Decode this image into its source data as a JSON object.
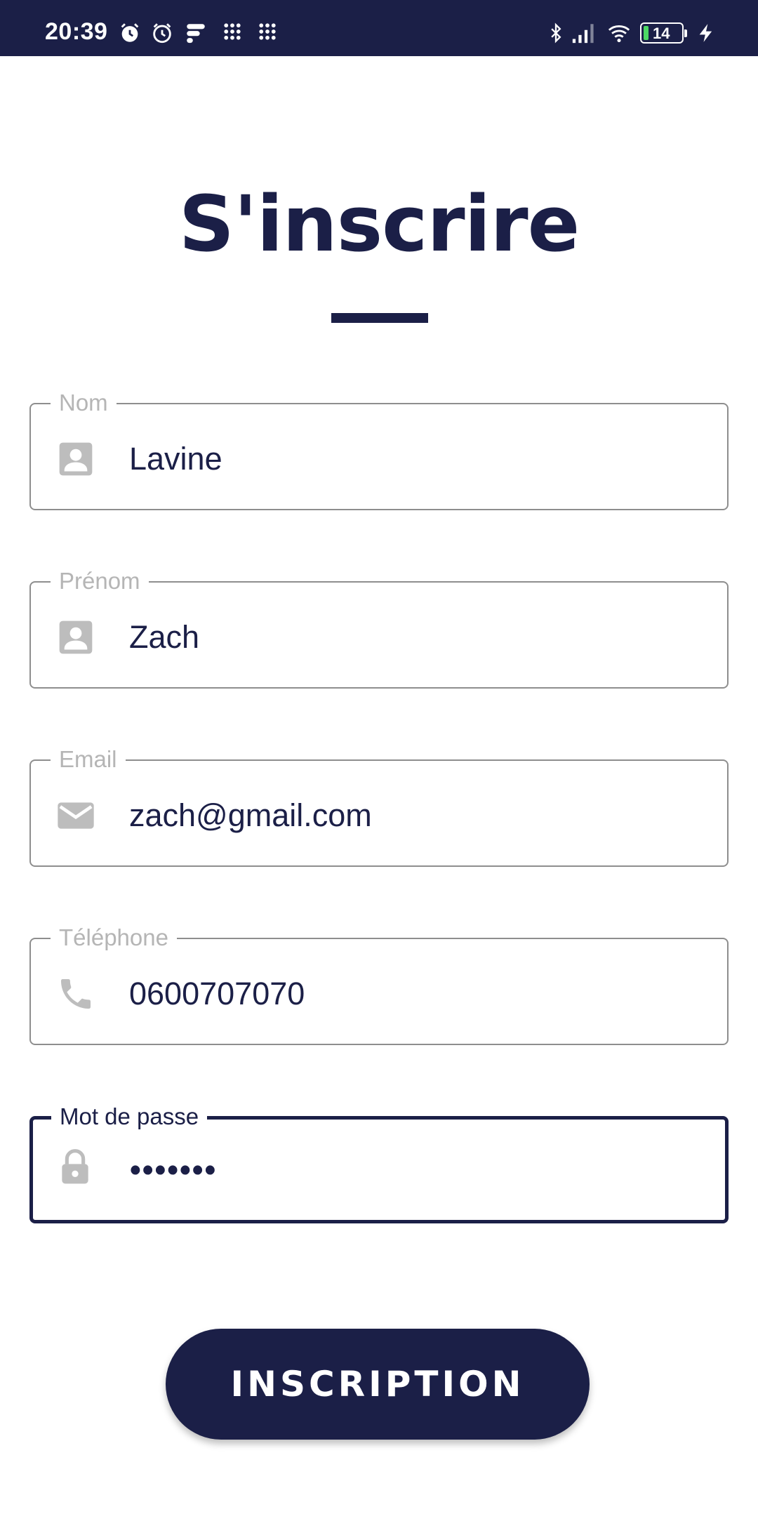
{
  "status_bar": {
    "time": "20:39",
    "battery": "14",
    "icons": [
      "alarm-icon",
      "alarm-clock-icon",
      "app-notification-icon",
      "grid-icon",
      "grid-icon",
      "bluetooth-icon",
      "signal-icon",
      "wifi-icon",
      "battery-icon",
      "charging-icon"
    ]
  },
  "page": {
    "title": "S'inscrire"
  },
  "form": {
    "fields": [
      {
        "label": "Nom",
        "value": "Lavine",
        "icon": "person-icon"
      },
      {
        "label": "Prénom",
        "value": "Zach",
        "icon": "person-icon"
      },
      {
        "label": "Email",
        "value": "zach@gmail.com",
        "icon": "mail-icon"
      },
      {
        "label": "Téléphone",
        "value": "0600707070",
        "icon": "phone-icon"
      },
      {
        "label": "Mot de passe",
        "value": "•••••••",
        "icon": "lock-icon",
        "focused": true
      }
    ],
    "submit_label": "INSCRIPTION"
  },
  "colors": {
    "primary": "#1b1f47",
    "border": "#8e8e8e",
    "placeholder": "#b5b5b5",
    "icon": "#bdbdbd"
  }
}
